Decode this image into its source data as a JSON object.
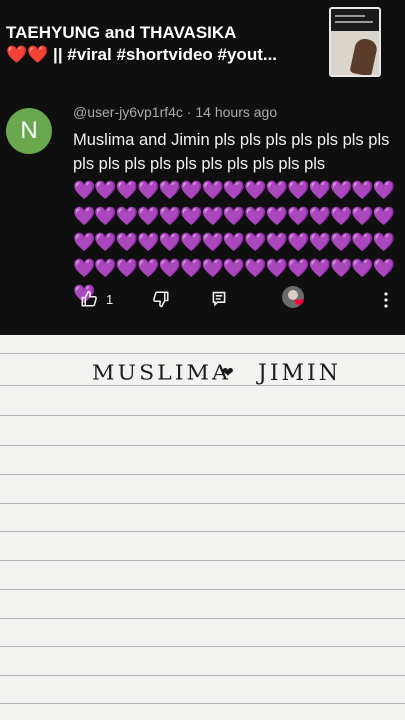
{
  "video": {
    "title_line1": "TAEHYUNG and THAVASIKA",
    "title_line2": "❤️❤️ || #viral #shortvideo #yout..."
  },
  "comment": {
    "avatar_letter": "N",
    "author": "@user-jy6vp1rf4c",
    "separator": " · ",
    "time": "14 hours ago",
    "text": "Muslima and Jimin pls pls pls pls pls pls pls pls pls pls pls pls pls pls pls pls pls",
    "hearts": "💜💜💜💜💜💜💜💜💜💜💜💜💜💜💜💜💜💜💜💜💜💜💜💜💜💜💜💜💜💜💜💜💜💜💜💜💜💜💜💜💜💜💜💜💜💜💜💜💜💜💜💜💜💜💜💜💜💜💜💜💜",
    "like_count": "1"
  },
  "icons": [
    "thumbs-up-icon",
    "thumbs-down-icon",
    "reply-icon",
    "creator-heart-icon",
    "more-vert-icon"
  ],
  "colors": {
    "avatar": "#6aa84f",
    "background": "#0f0f0f",
    "heart": "#ff0033",
    "paper": "#f2f2f1"
  },
  "paper_text": {
    "name1": "MUSLIMA",
    "heart": "❤",
    "name2": "JIMIN"
  }
}
